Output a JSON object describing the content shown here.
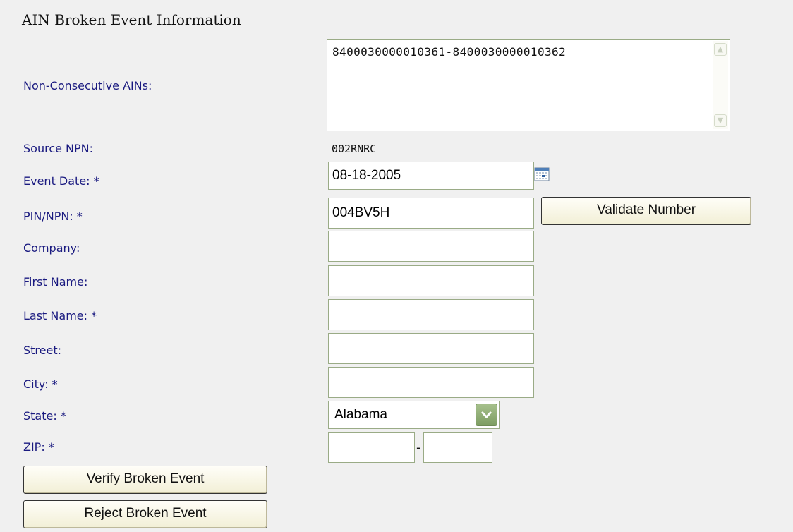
{
  "section_title": "AIN Broken Event Information",
  "labels": {
    "non_consecutive_ains": "Non-Consecutive AINs:",
    "source_npn": "Source NPN:",
    "event_date": "Event Date: *",
    "pin_npn": "PIN/NPN: *",
    "company": "Company:",
    "first_name": "First Name:",
    "last_name": "Last Name: *",
    "street": "Street:",
    "city": "City: *",
    "state": "State: *",
    "zip": "ZIP: *"
  },
  "values": {
    "non_consecutive_ains": "8400030000010361-8400030000010362",
    "source_npn": "002RNRC",
    "event_date": "08-18-2005",
    "pin_npn": "004BV5H",
    "company": "",
    "first_name": "",
    "last_name": "",
    "street": "",
    "city": "",
    "state": "Alabama",
    "zip_main": "",
    "zip_ext": ""
  },
  "zip_separator": "-",
  "buttons": {
    "validate_number": "Validate Number",
    "verify_broken_event": "Verify Broken Event",
    "reject_broken_event": "Reject Broken Event"
  },
  "icons": {
    "calendar": "calendar-icon",
    "scroll_up": "scroll-up-arrow-icon",
    "scroll_down": "scroll-down-arrow-icon",
    "dropdown": "dropdown-arrow-icon"
  },
  "colors": {
    "label_text": "#1a1a80",
    "field_border": "#9aab86",
    "dropdown_accent": "#7d9d62",
    "background": "#f0f0f0"
  }
}
